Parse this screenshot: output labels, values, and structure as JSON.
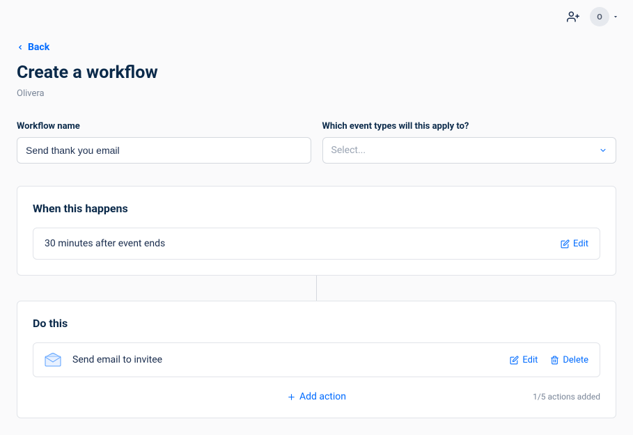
{
  "topbar": {
    "avatar_initial": "O"
  },
  "nav": {
    "back_label": "Back"
  },
  "header": {
    "title": "Create a workflow",
    "owner": "Olivera"
  },
  "form": {
    "name_label": "Workflow name",
    "name_value": "Send thank you email",
    "event_types_label": "Which event types will this apply to?",
    "event_types_placeholder": "Select..."
  },
  "trigger_section": {
    "title": "When this happens",
    "trigger_text": "30 minutes after event ends",
    "edit_label": "Edit"
  },
  "actions_section": {
    "title": "Do this",
    "action_text": "Send email to invitee",
    "edit_label": "Edit",
    "delete_label": "Delete",
    "add_action_label": "Add action",
    "actions_count_text": "1/5 actions added"
  }
}
